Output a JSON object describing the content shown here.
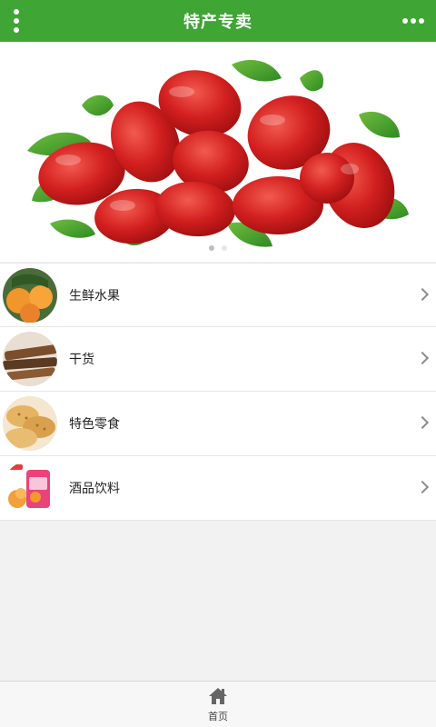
{
  "header": {
    "title": "特产专卖",
    "menu_icon": "menu-dots-vertical-icon",
    "more_icon": "more-dots-horizontal-icon"
  },
  "banner": {
    "description_subject": "red dates with green leaves",
    "slide_count": 2,
    "active_slide": 1
  },
  "categories": [
    {
      "label": "生鲜水果",
      "icon": "fruit-thumb"
    },
    {
      "label": "干货",
      "icon": "dried-goods-thumb"
    },
    {
      "label": "特色零食",
      "icon": "snacks-thumb"
    },
    {
      "label": "酒品饮料",
      "icon": "drinks-thumb"
    }
  ],
  "tabbar": {
    "home_label": "首页",
    "home_icon": "home-icon"
  },
  "colors": {
    "header_bg": "#3fa535",
    "page_bg": "#f2f2f2"
  }
}
